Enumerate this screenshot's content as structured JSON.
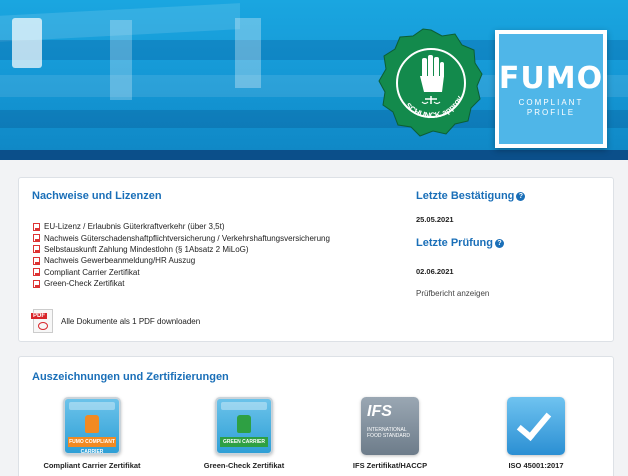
{
  "header": {
    "seal_text": "SCHUNCK approved",
    "logo": {
      "title": "FUMO",
      "subtitle_line1": "COMPLIANT",
      "subtitle_line2": "PROFILE"
    }
  },
  "evidence": {
    "title": "Nachweise und Lizenzen",
    "documents": [
      "EU-Lizenz / Erlaubnis Güterkraftverkehr (über 3,5t)",
      "Nachweis Güterschadenshaftpflichtversicherung / Verkehrshaftungsversicherung",
      "Selbstauskunft Zahlung Mindestlohn (§ 1Absatz 2 MiLoG)",
      "Nachweis Gewerbeanmeldung/HR Auszug",
      "Compliant Carrier Zertifikat",
      "Green-Check Zertifikat"
    ],
    "download_all": "Alle Dokumente als 1 PDF downloaden",
    "pdf_icon_tag": "PDF"
  },
  "status": {
    "last_confirmation_label": "Letzte Bestätigung",
    "last_confirmation_date": "25.05.2021",
    "last_check_label": "Letzte Prüfung",
    "last_check_date": "02.06.2021",
    "report_link": "Prüfbericht anzeigen",
    "help_glyph": "?"
  },
  "awards": {
    "title": "Auszeichnungen und Zertifizierungen",
    "items": [
      {
        "label": "Compliant Carrier Zertifikat",
        "badge_text": "FUMO COMPLIANT CARRIER",
        "icon": "compliant-carrier-badge-icon"
      },
      {
        "label": "Green-Check Zertifikat",
        "badge_text": "GREEN CARRIER",
        "icon": "green-carrier-badge-icon"
      },
      {
        "label": "IFS Zertifikat/HACCP",
        "badge_text": "IFS",
        "badge_sub": "INTERNATIONAL FOOD STANDARD",
        "icon": "ifs-badge-icon"
      },
      {
        "label": "ISO 45001:2017",
        "icon": "iso-check-badge-icon"
      }
    ]
  },
  "colors": {
    "banner": "#1496d4",
    "accent": "#1a6fb8",
    "pdf_red": "#d8262b"
  }
}
